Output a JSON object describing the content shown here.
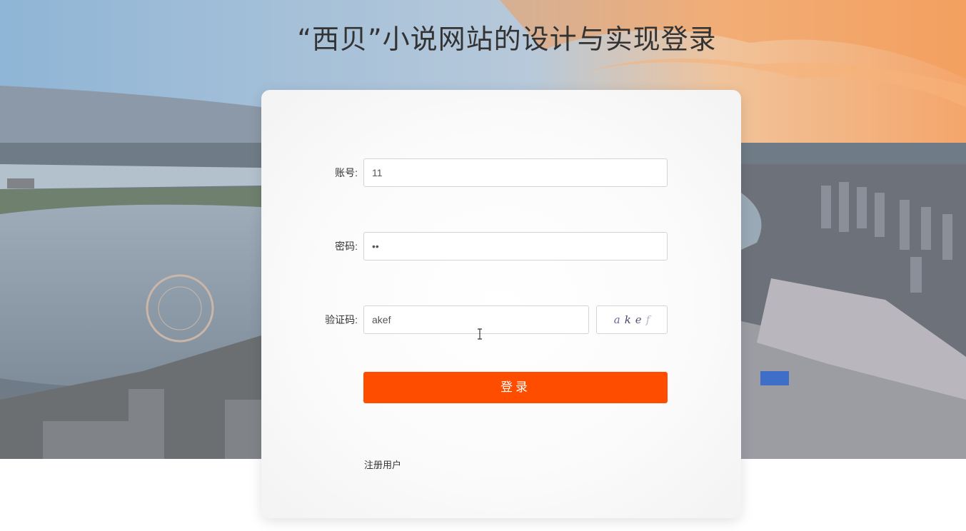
{
  "page": {
    "title": "“西贝”小说网站的设计与实现登录"
  },
  "form": {
    "account_label": "账号:",
    "account_value": "11",
    "password_label": "密码:",
    "password_value": "••",
    "captcha_label": "验证码:",
    "captcha_value": "akef",
    "captcha_chars": [
      "a",
      "k",
      "e",
      "f"
    ],
    "login_label": "登录",
    "register_label": "注册用户"
  },
  "colors": {
    "login_button": "#ff4d00",
    "text": "#333333"
  }
}
